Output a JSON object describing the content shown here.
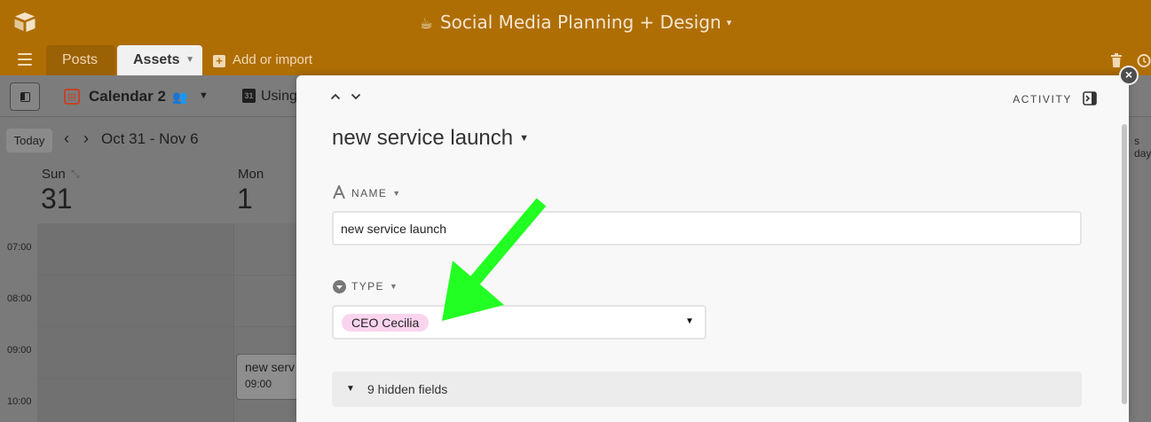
{
  "app": {
    "base_title": "Social Media Planning + Design",
    "tabs": [
      {
        "label": "Posts"
      },
      {
        "label": "Assets"
      }
    ],
    "add_or_import_label": "Add or import"
  },
  "view": {
    "name": "Calendar 2",
    "date_field_prefix": "Using",
    "date_icon_text": "31",
    "today_label": "Today",
    "date_range": "Oct 31 - Nov 6",
    "day_toggle_partial": "s day",
    "days": [
      {
        "name": "Sun",
        "number": "31"
      },
      {
        "name": "Mon",
        "number": "1"
      }
    ],
    "times": [
      "07:00",
      "08:00",
      "09:00",
      "10:00"
    ],
    "event": {
      "title": "new serv",
      "time": "09:00"
    }
  },
  "record": {
    "title": "new service launch",
    "activity_label": "ACTIVITY",
    "name_field": {
      "label": "NAME",
      "value": "new service launch"
    },
    "type_field": {
      "label": "TYPE",
      "value": "CEO Cecilia",
      "pill_color": "#fad4ee"
    },
    "hidden_fields_label": "9 hidden fields"
  },
  "colors": {
    "brand": "#ae6e04",
    "annotation_arrow": "#22ff22"
  }
}
